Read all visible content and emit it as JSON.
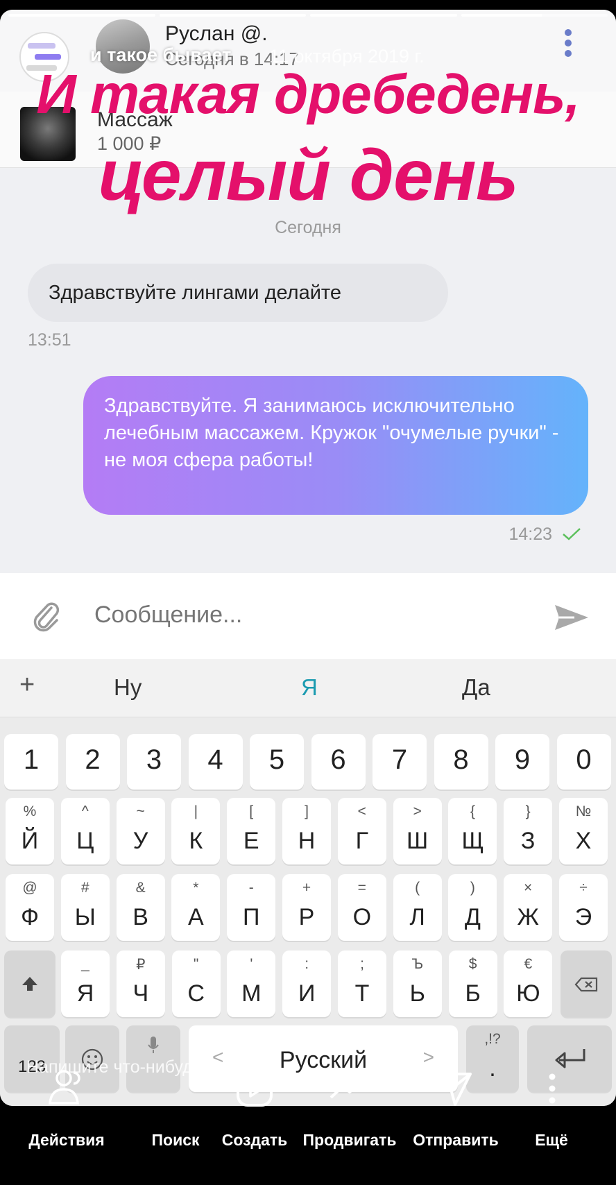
{
  "story": {
    "user": "и такое бывает",
    "date": "11 октября 2019 г.",
    "progress_segments": [
      1,
      1,
      1,
      0.55
    ],
    "caption_line1": "И такая дребедень,",
    "caption_line2": "целый день",
    "reply_placeholder": "Напишите что-нибудь...",
    "bottom_actions": [
      {
        "label": "Действия",
        "icon": "friends-icon"
      },
      {
        "label": "Поиск",
        "icon": "search-icon"
      },
      {
        "label": "Создать",
        "icon": "play-icon"
      },
      {
        "label": "Продвигать",
        "icon": "trend-icon"
      },
      {
        "label": "Отправить",
        "icon": "send-icon"
      },
      {
        "label": "Ещё",
        "icon": "more-icon"
      }
    ]
  },
  "chat": {
    "contact_name": "Руслан @.",
    "contact_time": "Сегодня в 14:17",
    "product_title": "Массаж",
    "product_price": "1 000 ₽",
    "date_separator": "Сегодня",
    "incoming_text": "Здравствуйте лингами делайте",
    "incoming_time": "13:51",
    "outgoing_text": "Здравствуйте. Я занимаюсь исключительно лечебным массажем. Кружок \"очумелые ручки\" - не моя сфера работы!",
    "outgoing_time": "14:23",
    "input_placeholder": "Сообщение..."
  },
  "keyboard": {
    "plus": "+",
    "suggestions": [
      "Ну",
      "Я",
      "Да"
    ],
    "numbers": [
      "1",
      "2",
      "3",
      "4",
      "5",
      "6",
      "7",
      "8",
      "9",
      "0"
    ],
    "row1": [
      [
        "%",
        "Й"
      ],
      [
        "^",
        "Ц"
      ],
      [
        "~",
        "У"
      ],
      [
        "|",
        "К"
      ],
      [
        "[",
        "Е"
      ],
      [
        "]",
        "Н"
      ],
      [
        "<",
        "Г"
      ],
      [
        ">",
        "Ш"
      ],
      [
        "{",
        "Щ"
      ],
      [
        "}",
        "З"
      ],
      [
        "№",
        "Х"
      ]
    ],
    "row2": [
      [
        "@",
        "Ф"
      ],
      [
        "#",
        "Ы"
      ],
      [
        "&",
        "В"
      ],
      [
        "*",
        "А"
      ],
      [
        "-",
        "П"
      ],
      [
        "+",
        "Р"
      ],
      [
        "=",
        "О"
      ],
      [
        "(",
        "Л"
      ],
      [
        ")",
        "Д"
      ],
      [
        "×",
        "Ж"
      ],
      [
        "÷",
        "Э"
      ]
    ],
    "row3": [
      [
        "_",
        "Я"
      ],
      [
        "₽",
        "Ч"
      ],
      [
        "\"",
        "С"
      ],
      [
        "'",
        "М"
      ],
      [
        ":",
        "И"
      ],
      [
        ";",
        "Т"
      ],
      [
        "Ъ",
        "Ь"
      ],
      [
        "$",
        "Б"
      ],
      [
        "€",
        "Ю"
      ]
    ],
    "sym_key": "123",
    "space_label": "Русский",
    "punct_alt": ",!?",
    "punct_main": "."
  }
}
